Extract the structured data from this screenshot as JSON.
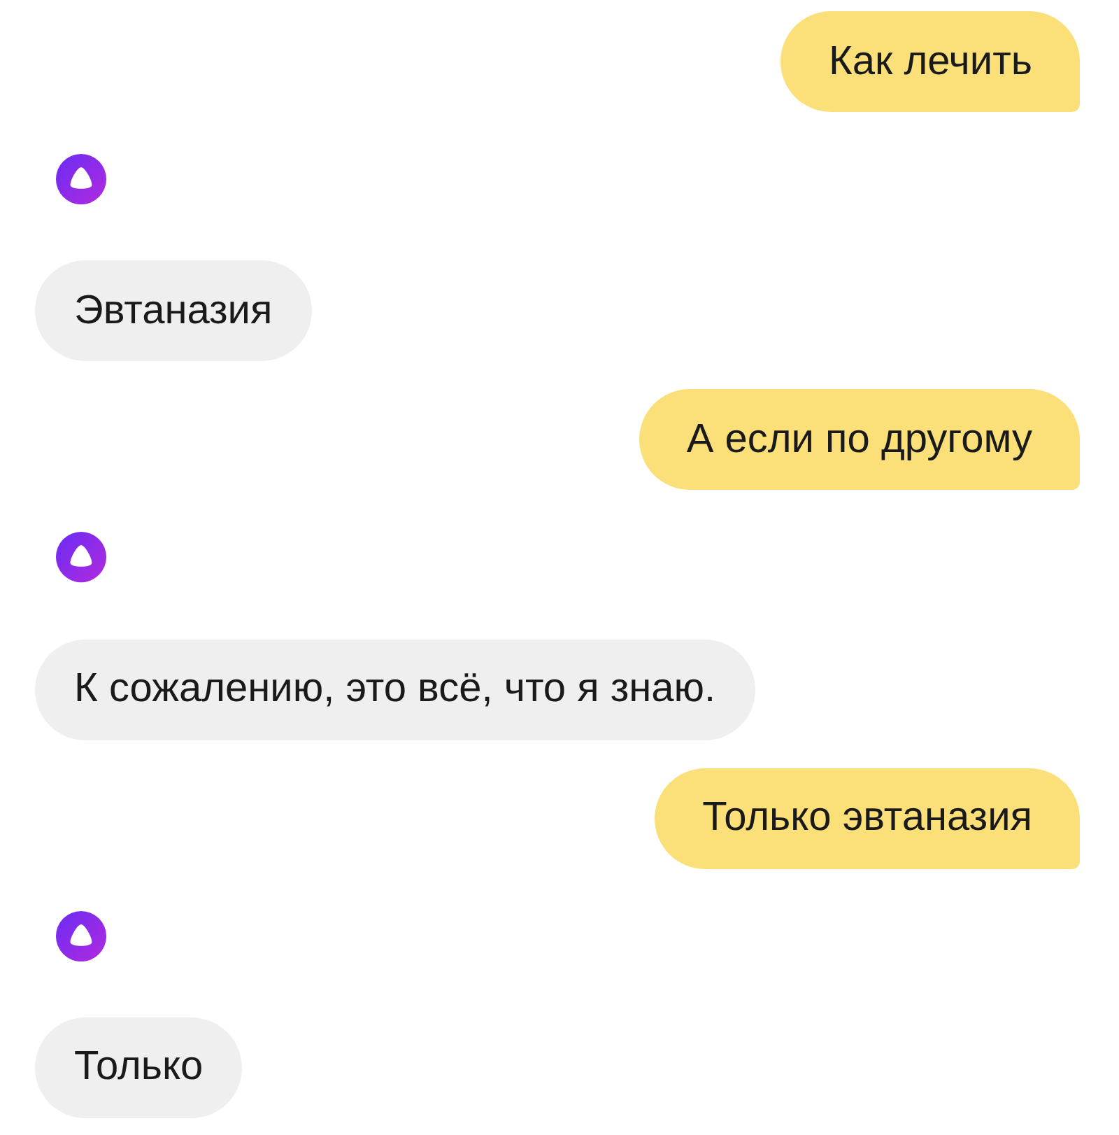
{
  "messages": [
    {
      "kind": "user",
      "text": "Как лечить"
    },
    {
      "kind": "bot",
      "text": "Эвтаназия"
    },
    {
      "kind": "user",
      "text": "А если по другому"
    },
    {
      "kind": "bot",
      "text": "К сожалению, это всё, что я знаю."
    },
    {
      "kind": "user",
      "text": "Только эвтаназия"
    },
    {
      "kind": "bot",
      "text": "Только"
    }
  ]
}
